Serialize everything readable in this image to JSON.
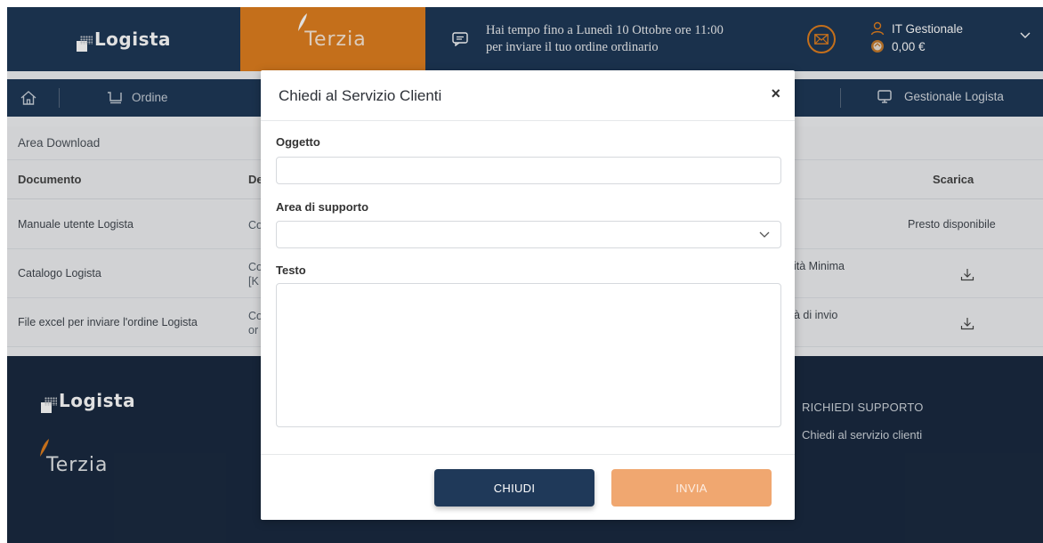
{
  "header": {
    "brand_logista": "Logista",
    "brand_terzia": "Terzia",
    "notice_line1": "Hai tempo fino a Lunedì 10 Ottobre ore 11:00",
    "notice_line2": "per inviare il tuo ordine ordinario",
    "user_name": "IT Gestionale",
    "user_balance": "0,00 €",
    "icons": {
      "chat": "chat-icon",
      "mail": "mail-icon",
      "user": "user-icon",
      "wallet": "wallet-icon",
      "chevron": "chevron-down-icon"
    }
  },
  "nav": {
    "ordine_label": "Ordine",
    "gestionale_label": "Gestionale Logista",
    "icons": {
      "home": "home-icon",
      "cart": "cart-icon",
      "monitor": "monitor-icon"
    }
  },
  "main": {
    "section_title": "Area Download",
    "columns": {
      "documento": "Documento",
      "descrizione_partial": "De",
      "scarica": "Scarica"
    },
    "rows": [
      {
        "documento": "Manuale utente Logista",
        "descrizione_partial": "Co",
        "right_partial": "",
        "scarica": "Presto disponibile"
      },
      {
        "documento": "Catalogo Logista",
        "descrizione_partial": "Co [K",
        "right_partial": "ità Minima",
        "scarica": ""
      },
      {
        "documento": "File excel per inviare l'ordine Logista",
        "descrizione_partial": "Co or",
        "right_partial": "à di invio",
        "scarica": ""
      }
    ]
  },
  "footer": {
    "brand_logista": "Logista",
    "brand_terzia": "Terzia",
    "support_heading": "RICHIEDI SUPPORTO",
    "support_link": "Chiedi al servizio clienti"
  },
  "modal": {
    "title": "Chiedi al Servizio Clienti",
    "close_label": "×",
    "oggetto_label": "Oggetto",
    "oggetto_value": "",
    "area_label": "Area di supporto",
    "area_value": "",
    "testo_label": "Testo",
    "testo_value": "",
    "chiudi_label": "CHIUDI",
    "invia_label": "INVIA"
  },
  "colors": {
    "navy": "#1e3857",
    "orange": "#e07f1f",
    "invia_disabled": "#f0a770",
    "footer_bg": "#1a2a40"
  }
}
